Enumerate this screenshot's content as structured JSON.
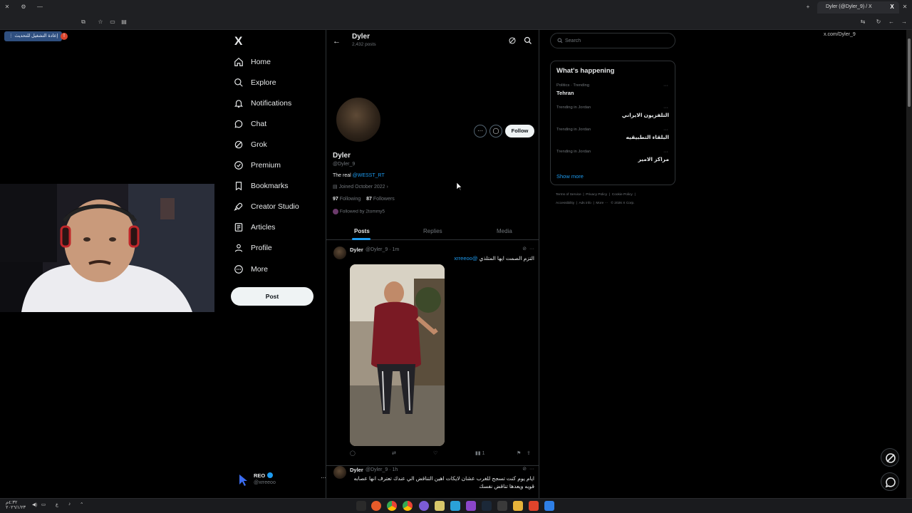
{
  "browser": {
    "tab_title": "Dyler (@Dyler_9) / X",
    "address": "x.com/Dyler_9",
    "update_button": "إعادة التشغيل للتحديث",
    "notification_count": "!"
  },
  "nav": {
    "logo": "X",
    "items": [
      {
        "label": "Home",
        "icon": "home-icon"
      },
      {
        "label": "Explore",
        "icon": "search-icon"
      },
      {
        "label": "Notifications",
        "icon": "bell-icon"
      },
      {
        "label": "Chat",
        "icon": "chat-icon"
      },
      {
        "label": "Grok",
        "icon": "grok-icon"
      },
      {
        "label": "Premium",
        "icon": "verified-icon"
      },
      {
        "label": "Bookmarks",
        "icon": "bookmark-icon"
      },
      {
        "label": "Creator Studio",
        "icon": "rocket-icon"
      },
      {
        "label": "Articles",
        "icon": "articles-icon"
      },
      {
        "label": "Profile",
        "icon": "person-icon"
      },
      {
        "label": "More",
        "icon": "more-circle-icon"
      }
    ],
    "post_label": "Post",
    "account": {
      "name": "REO",
      "handle": "@xrreeoo"
    }
  },
  "profile": {
    "header_name": "Dyler",
    "post_count": "2,432 posts",
    "name": "Dyler",
    "handle": "@Dyler_9",
    "bio_prefix": "The real ",
    "bio_link": "@WESST_RT",
    "joined": "Joined October 2022",
    "following_count": "97",
    "following_label": "Following",
    "followers_count": "87",
    "followers_label": "Followers",
    "followed_by": "Followed by 2tommy5",
    "follow_label": "Follow",
    "tabs": [
      "Posts",
      "Replies",
      "Media"
    ],
    "active_tab": "Posts"
  },
  "tweets": [
    {
      "name": "Dyler",
      "meta": "@Dyler_9 · 1m",
      "text": "التزم الصمت ايها المتلذي",
      "mention": "@xrreeoo",
      "views": "1"
    },
    {
      "name": "Dyler",
      "meta": "@Dyler_9 · 1h",
      "text_line1": "ايام يوم كنت تسجح للغرب عشان لايكات اهين التناقض الي عندك تعترف انها عصابه",
      "text_line2": "قويه ويعدها تناقض نفسك"
    }
  ],
  "right": {
    "search_placeholder": "Search",
    "trends_title": "What's happening",
    "trends": [
      {
        "meta": "Politics · Trending",
        "name": "Tehran"
      },
      {
        "meta": "Trending in Jordan",
        "name": "التلفزيون الايراني"
      },
      {
        "meta": "Trending in Jordan",
        "name": "البلقاء التطبيقيه"
      },
      {
        "meta": "Trending in Jordan",
        "name": "مراكز الامير"
      }
    ],
    "show_more": "Show more",
    "footer_line1": [
      "Terms of Service",
      "Privacy Policy",
      "Cookie Policy"
    ],
    "footer_line2": [
      "Accessibility",
      "Ads info",
      "More ···",
      "© 2026 X Corp."
    ]
  },
  "taskbar": {
    "clock": "٤:٣٢م",
    "date": "٢٠٢٦/١/٢٣",
    "lang": "ع"
  },
  "colors": {
    "accent": "#1d9bf0",
    "background": "#000000",
    "border": "#2f3336",
    "muted": "#71767b"
  }
}
